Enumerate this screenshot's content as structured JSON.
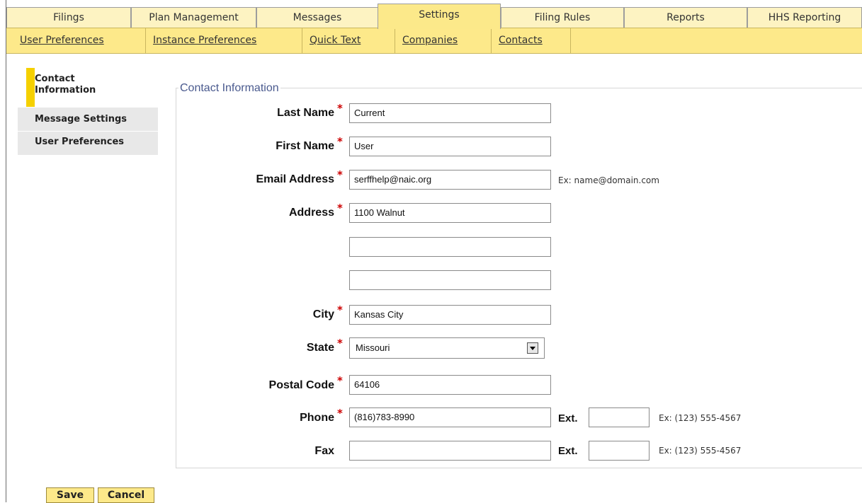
{
  "tabs": [
    {
      "label": "Filings",
      "active": false
    },
    {
      "label": "Plan Management",
      "active": false
    },
    {
      "label": "Messages",
      "active": false
    },
    {
      "label": "Settings",
      "active": true
    },
    {
      "label": "Filing Rules",
      "active": false
    },
    {
      "label": "Reports",
      "active": false
    },
    {
      "label": "HHS Reporting",
      "active": false
    }
  ],
  "subtabs": [
    "User Preferences",
    "Instance Preferences",
    "Quick Text",
    "Companies",
    "Contacts"
  ],
  "leftnav": [
    {
      "label": "Contact Information",
      "active": true
    },
    {
      "label": "Message Settings",
      "active": false
    },
    {
      "label": "User Preferences",
      "active": false
    }
  ],
  "form": {
    "legend": "Contact Information",
    "required_mark": "*",
    "last_name": {
      "label": "Last Name",
      "value": "Current"
    },
    "first_name": {
      "label": "First Name",
      "value": "User"
    },
    "email": {
      "label": "Email Address",
      "value": "serffhelp@naic.org",
      "hint": "Ex: name@domain.com"
    },
    "address": {
      "label": "Address",
      "line1": "1100 Walnut",
      "line2": "",
      "line3": ""
    },
    "city": {
      "label": "City",
      "value": "Kansas City"
    },
    "state": {
      "label": "State",
      "value": "Missouri"
    },
    "postal": {
      "label": "Postal Code",
      "value": "64106"
    },
    "phone": {
      "label": "Phone",
      "value": "(816)783-8990",
      "ext_label": "Ext.",
      "ext_value": "",
      "hint": "Ex: (123) 555-4567"
    },
    "fax": {
      "label": "Fax",
      "value": "",
      "ext_label": "Ext.",
      "ext_value": "",
      "hint": "Ex: (123) 555-4567"
    }
  },
  "buttons": {
    "save": "Save",
    "cancel": "Cancel"
  },
  "colors": {
    "tab_bg": "#fdf3c2",
    "active_tab": "#fce98a",
    "subbar": "#fde98a",
    "active_marker": "#f5d000",
    "required": "#cc0000"
  }
}
